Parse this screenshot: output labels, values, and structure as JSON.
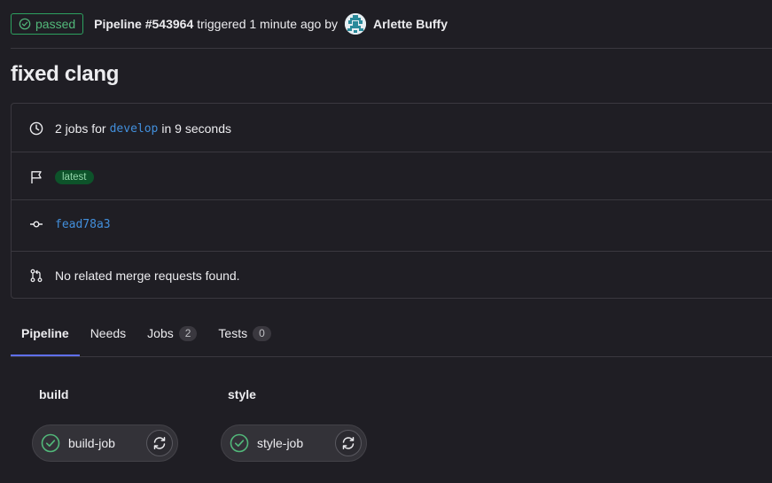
{
  "header": {
    "status": "passed",
    "pipeline_id": "Pipeline #543964",
    "triggered_text": "triggered 1 minute ago by",
    "author": "Arlette Buffy"
  },
  "title": "fixed clang",
  "info": {
    "jobs_prefix": "2 jobs for",
    "branch": "develop",
    "jobs_suffix": "in 9 seconds",
    "tag": "latest",
    "commit": "fead78a3",
    "merge_requests": "No related merge requests found."
  },
  "tabs": [
    {
      "label": "Pipeline",
      "count": null
    },
    {
      "label": "Needs",
      "count": null
    },
    {
      "label": "Jobs",
      "count": "2"
    },
    {
      "label": "Tests",
      "count": "0"
    }
  ],
  "stages": [
    {
      "title": "build",
      "job": "build-job"
    },
    {
      "title": "style",
      "job": "style-job"
    }
  ],
  "colors": {
    "background": "#1f1e24",
    "success": "#52b87a",
    "link": "#428fdc",
    "tab_active": "#5f6ff0"
  },
  "icons": {
    "status": "check-circle-icon",
    "duration": "clock-icon",
    "tag": "flag-icon",
    "commit": "commit-icon",
    "merge": "merge-request-icon",
    "job_status": "check-circle-icon",
    "retry": "retry-icon"
  }
}
